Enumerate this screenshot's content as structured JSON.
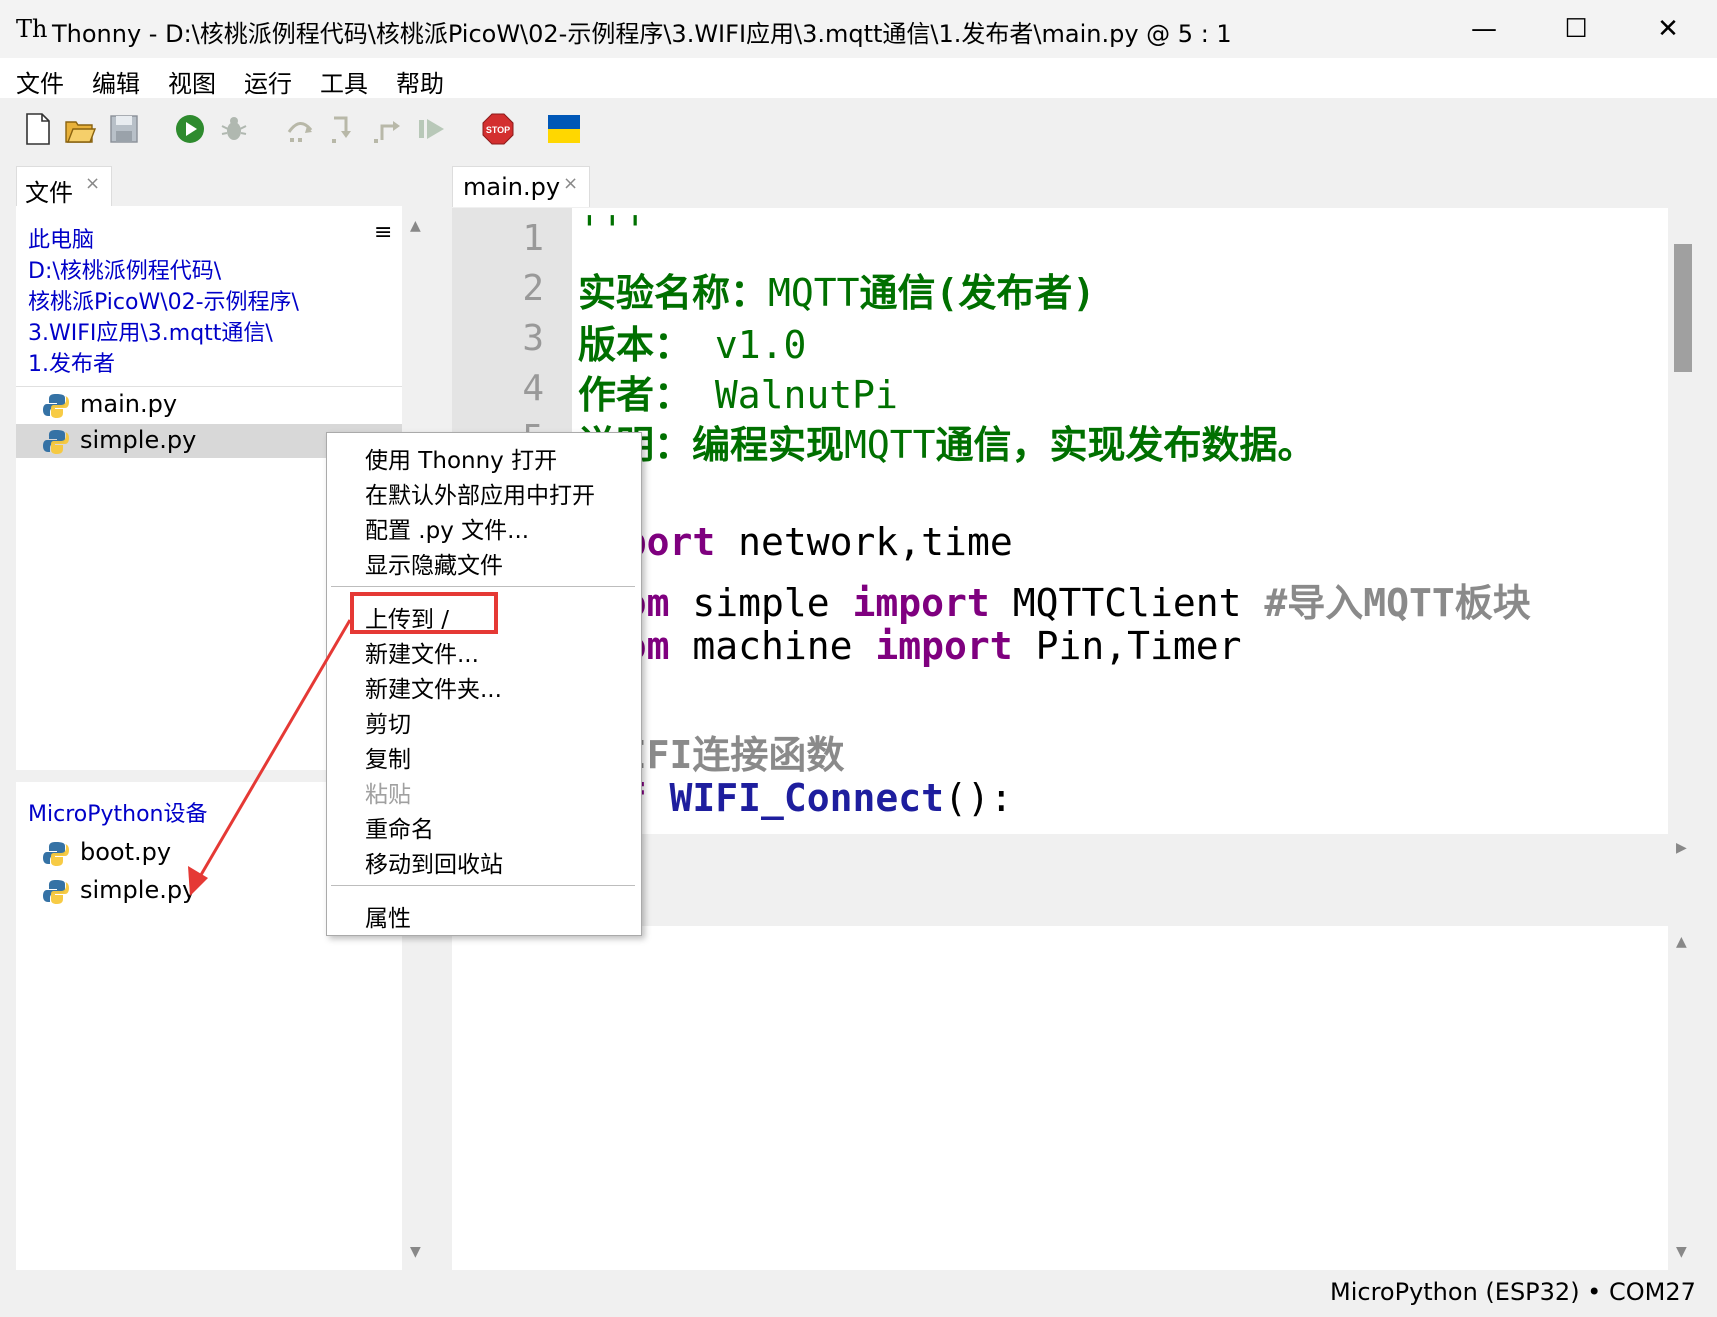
{
  "window": {
    "title": "Thonny  -  D:\\核桃派例程代码\\核桃派PicoW\\02-示例程序\\3.WIFI应用\\3.mqtt通信\\1.发布者\\main.py  @  5 : 1",
    "app_icon_text": "Th",
    "minimize": "—",
    "maximize": "☐",
    "close": "✕"
  },
  "menu": [
    "文件",
    "编辑",
    "视图",
    "运行",
    "工具",
    "帮助"
  ],
  "toolbar": {
    "icons": [
      "new-file-icon",
      "open-file-icon",
      "save-file-icon",
      "run-icon",
      "debug-icon",
      "step-over-icon",
      "step-into-icon",
      "step-out-icon",
      "resume-icon",
      "stop-icon",
      "ukraine-flag-icon"
    ],
    "stop_label": "STOP",
    "colors": {
      "run": "#2e8b2e",
      "stop": "#d32f2f",
      "flag_blue": "#0057b7",
      "flag_yellow": "#ffd700"
    }
  },
  "files_panel": {
    "tab_label": "文件",
    "tab_close": "×",
    "menu_glyph": "≡",
    "local_path": [
      "此电脑",
      "D:\\核桃派例程代码\\",
      "核桃派PicoW\\02-示例程序\\",
      "3.WIFI应用\\3.mqtt通信\\",
      "1.发布者"
    ],
    "local_files": [
      "main.py",
      "simple.py"
    ],
    "device_label": "MicroPython设备",
    "device_files": [
      "boot.py",
      "simple.py"
    ],
    "scroll_up": "▲",
    "scroll_down": "▼"
  },
  "editor": {
    "tab_label": "main.py",
    "tab_close": "×",
    "line_numbers": [
      "1",
      "2",
      "3",
      "4",
      "5"
    ],
    "code": {
      "l1": "'''",
      "l2a": "实验名称：",
      "l2b": "MQTT",
      "l2c": "通信",
      "l2d": "(发布者)",
      "l3a": "版本：",
      "l3b": " v1.0",
      "l4a": "作者：",
      "l4b": " WalnutPi",
      "l5a": "说明：编程实现",
      "l5b": "MQTT",
      "l5c": "通信，实现发布数据。",
      "l7a": "import",
      "l7b": " network,time",
      "l8a": "from",
      "l8b": " simple ",
      "l8c": "import",
      "l8d": " MQTTClient ",
      "l8e": "#导入MQTT板块",
      "l9a": "from",
      "l9b": " machine ",
      "l9c": "import",
      "l9d": " Pin,Timer",
      "l11": "#WIFI连接函数",
      "l12a": "def",
      "l12b": " WIFI_Connect",
      "l12c": "():"
    },
    "scroll_right": "▶"
  },
  "shell": {
    "scroll_up": "▲",
    "scroll_down": "▼"
  },
  "status": {
    "text": "MicroPython (ESP32)  •  COM27"
  },
  "context_menu": {
    "items": [
      "使用 Thonny 打开",
      "在默认外部应用中打开",
      "配置 .py 文件...",
      "显示隐藏文件",
      "上传到 /",
      "新建文件...",
      "新建文件夹...",
      "剪切",
      "复制",
      "粘贴",
      "重命名",
      "移动到回收站",
      "属性"
    ],
    "highlight_color": "#e53935"
  }
}
